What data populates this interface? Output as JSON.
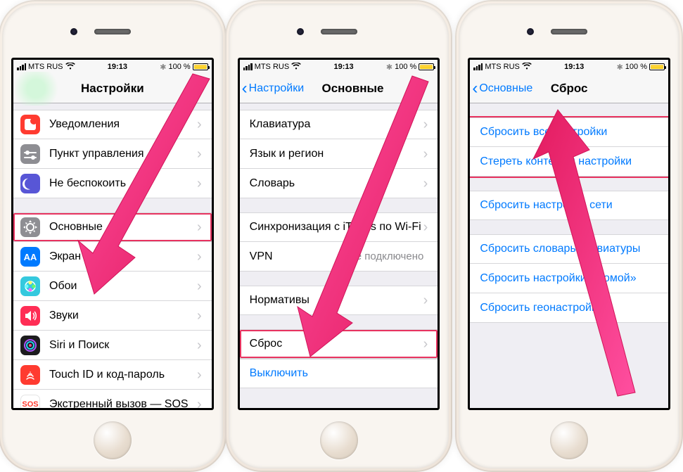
{
  "status": {
    "carrier": "MTS RUS",
    "time": "19:13",
    "battery": "100 %"
  },
  "phone1": {
    "title": "Настройки",
    "group1": [
      {
        "label": "Уведомления",
        "icon": "notif"
      },
      {
        "label": "Пункт управления",
        "icon": "control"
      },
      {
        "label": "Не беспокоить",
        "icon": "dnd"
      }
    ],
    "group2": [
      {
        "label": "Основные",
        "icon": "general",
        "hl": true
      },
      {
        "label": "Экран и яркость",
        "icon": "display"
      },
      {
        "label": "Обои",
        "icon": "wallpaper"
      },
      {
        "label": "Звуки",
        "icon": "sounds"
      },
      {
        "label": "Siri и Поиск",
        "icon": "siri"
      },
      {
        "label": "Touch ID и код-пароль",
        "icon": "touchid"
      },
      {
        "label": "Экстренный вызов — SOS",
        "icon": "sos"
      }
    ]
  },
  "phone2": {
    "back": "Настройки",
    "title": "Основные",
    "group1": [
      {
        "label": "Клавиатура"
      },
      {
        "label": "Язык и регион"
      },
      {
        "label": "Словарь"
      }
    ],
    "group2": [
      {
        "label": "Синхронизация с iTunes по Wi-Fi"
      },
      {
        "label": "VPN",
        "value": "Не подключено"
      }
    ],
    "group3": [
      {
        "label": "Нормативы"
      }
    ],
    "group4": [
      {
        "label": "Сброс",
        "hl": true
      }
    ],
    "shutdown": "Выключить"
  },
  "phone3": {
    "back": "Основные",
    "title": "Сброс",
    "group1": [
      {
        "label": "Сбросить все настройки"
      },
      {
        "label": "Стереть контент и настройки"
      }
    ],
    "group2": [
      {
        "label": "Сбросить настройки сети"
      }
    ],
    "group3": [
      {
        "label": "Сбросить словарь клавиатуры"
      },
      {
        "label": "Сбросить настройки «Домой»"
      },
      {
        "label": "Сбросить геонастройки"
      }
    ]
  },
  "iconcolors": {
    "notif": "#ff3b30",
    "control": "#8e8e93",
    "dnd": "#5856d6",
    "general": "#8e8e93",
    "display": "#007aff",
    "wallpaper": "#35c9de",
    "sounds": "#ff2d55",
    "siri": "#1c1c1e",
    "touchid": "#ff3b30",
    "sos": "#ffffff"
  }
}
